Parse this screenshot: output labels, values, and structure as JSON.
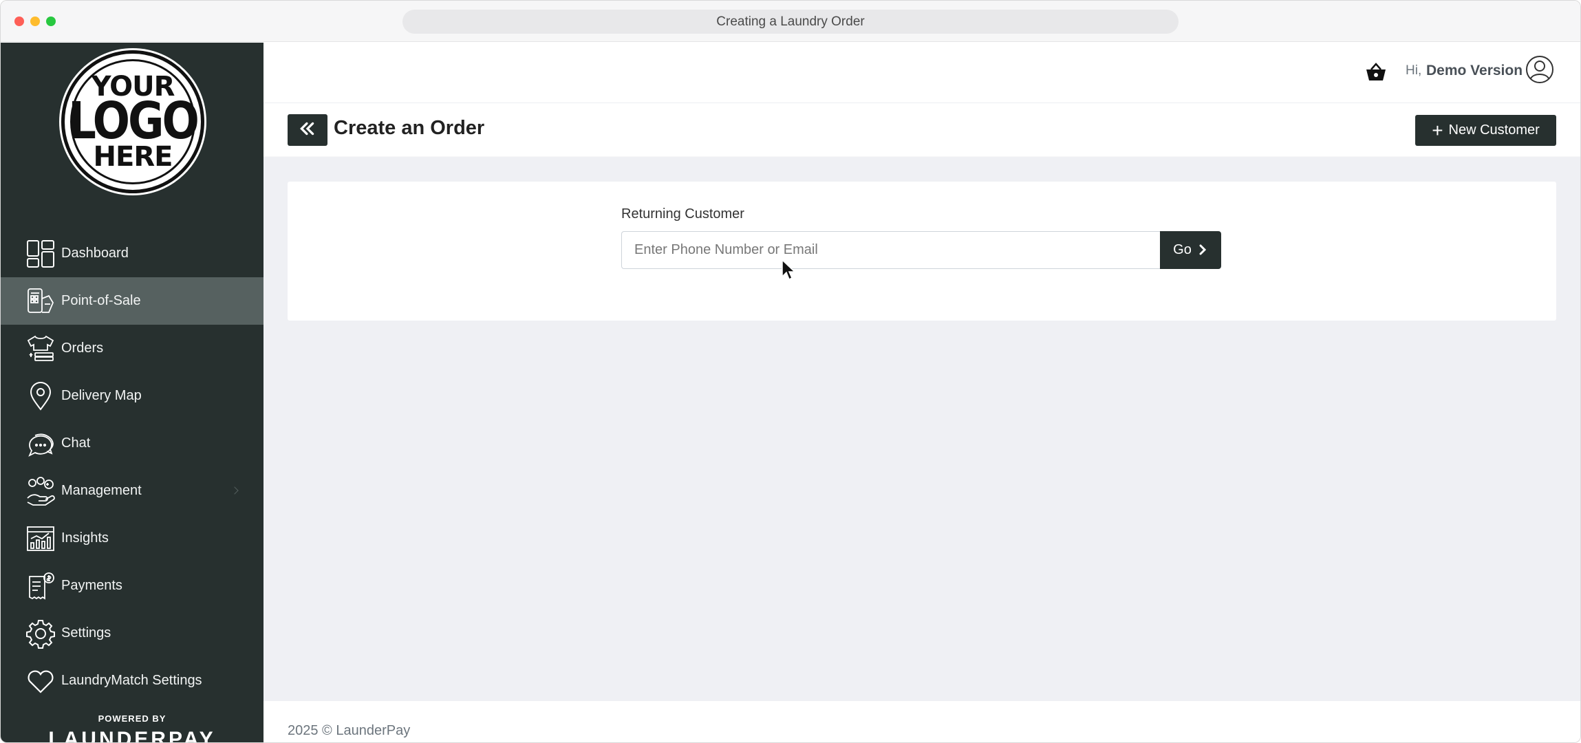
{
  "window": {
    "title": "Creating a Laundry Order"
  },
  "logo": {
    "line1": "YOUR",
    "line2": "LOGO",
    "line3": "HERE"
  },
  "sidebar": {
    "items": [
      {
        "label": "Dashboard",
        "icon": "dashboard-icon"
      },
      {
        "label": "Point-of-Sale",
        "icon": "point-of-sale-icon",
        "active": true
      },
      {
        "label": "Orders",
        "icon": "orders-icon"
      },
      {
        "label": "Delivery Map",
        "icon": "map-pin-icon"
      },
      {
        "label": "Chat",
        "icon": "chat-icon"
      },
      {
        "label": "Management",
        "icon": "management-icon"
      },
      {
        "label": "Insights",
        "icon": "insights-icon"
      },
      {
        "label": "Payments",
        "icon": "payments-icon"
      },
      {
        "label": "Settings",
        "icon": "gear-icon"
      },
      {
        "label": "LaundryMatch Settings",
        "icon": "heart-icon"
      }
    ],
    "powered_by": "POWERED BY",
    "brand": "LAUNDERPAY"
  },
  "header": {
    "greeting": "Hi,",
    "user_name": "Demo Version"
  },
  "page": {
    "title": "Create an Order",
    "new_customer_label": "New Customer"
  },
  "search": {
    "label": "Returning Customer",
    "placeholder": "Enter Phone Number or Email",
    "value": "",
    "go_label": "Go"
  },
  "footer": {
    "copyright": "2025 © LaunderPay"
  },
  "colors": {
    "sidebar_bg": "#27302f",
    "active_item_bg": "#566160",
    "content_bg": "#eff0f4",
    "button_bg": "#27302f"
  }
}
